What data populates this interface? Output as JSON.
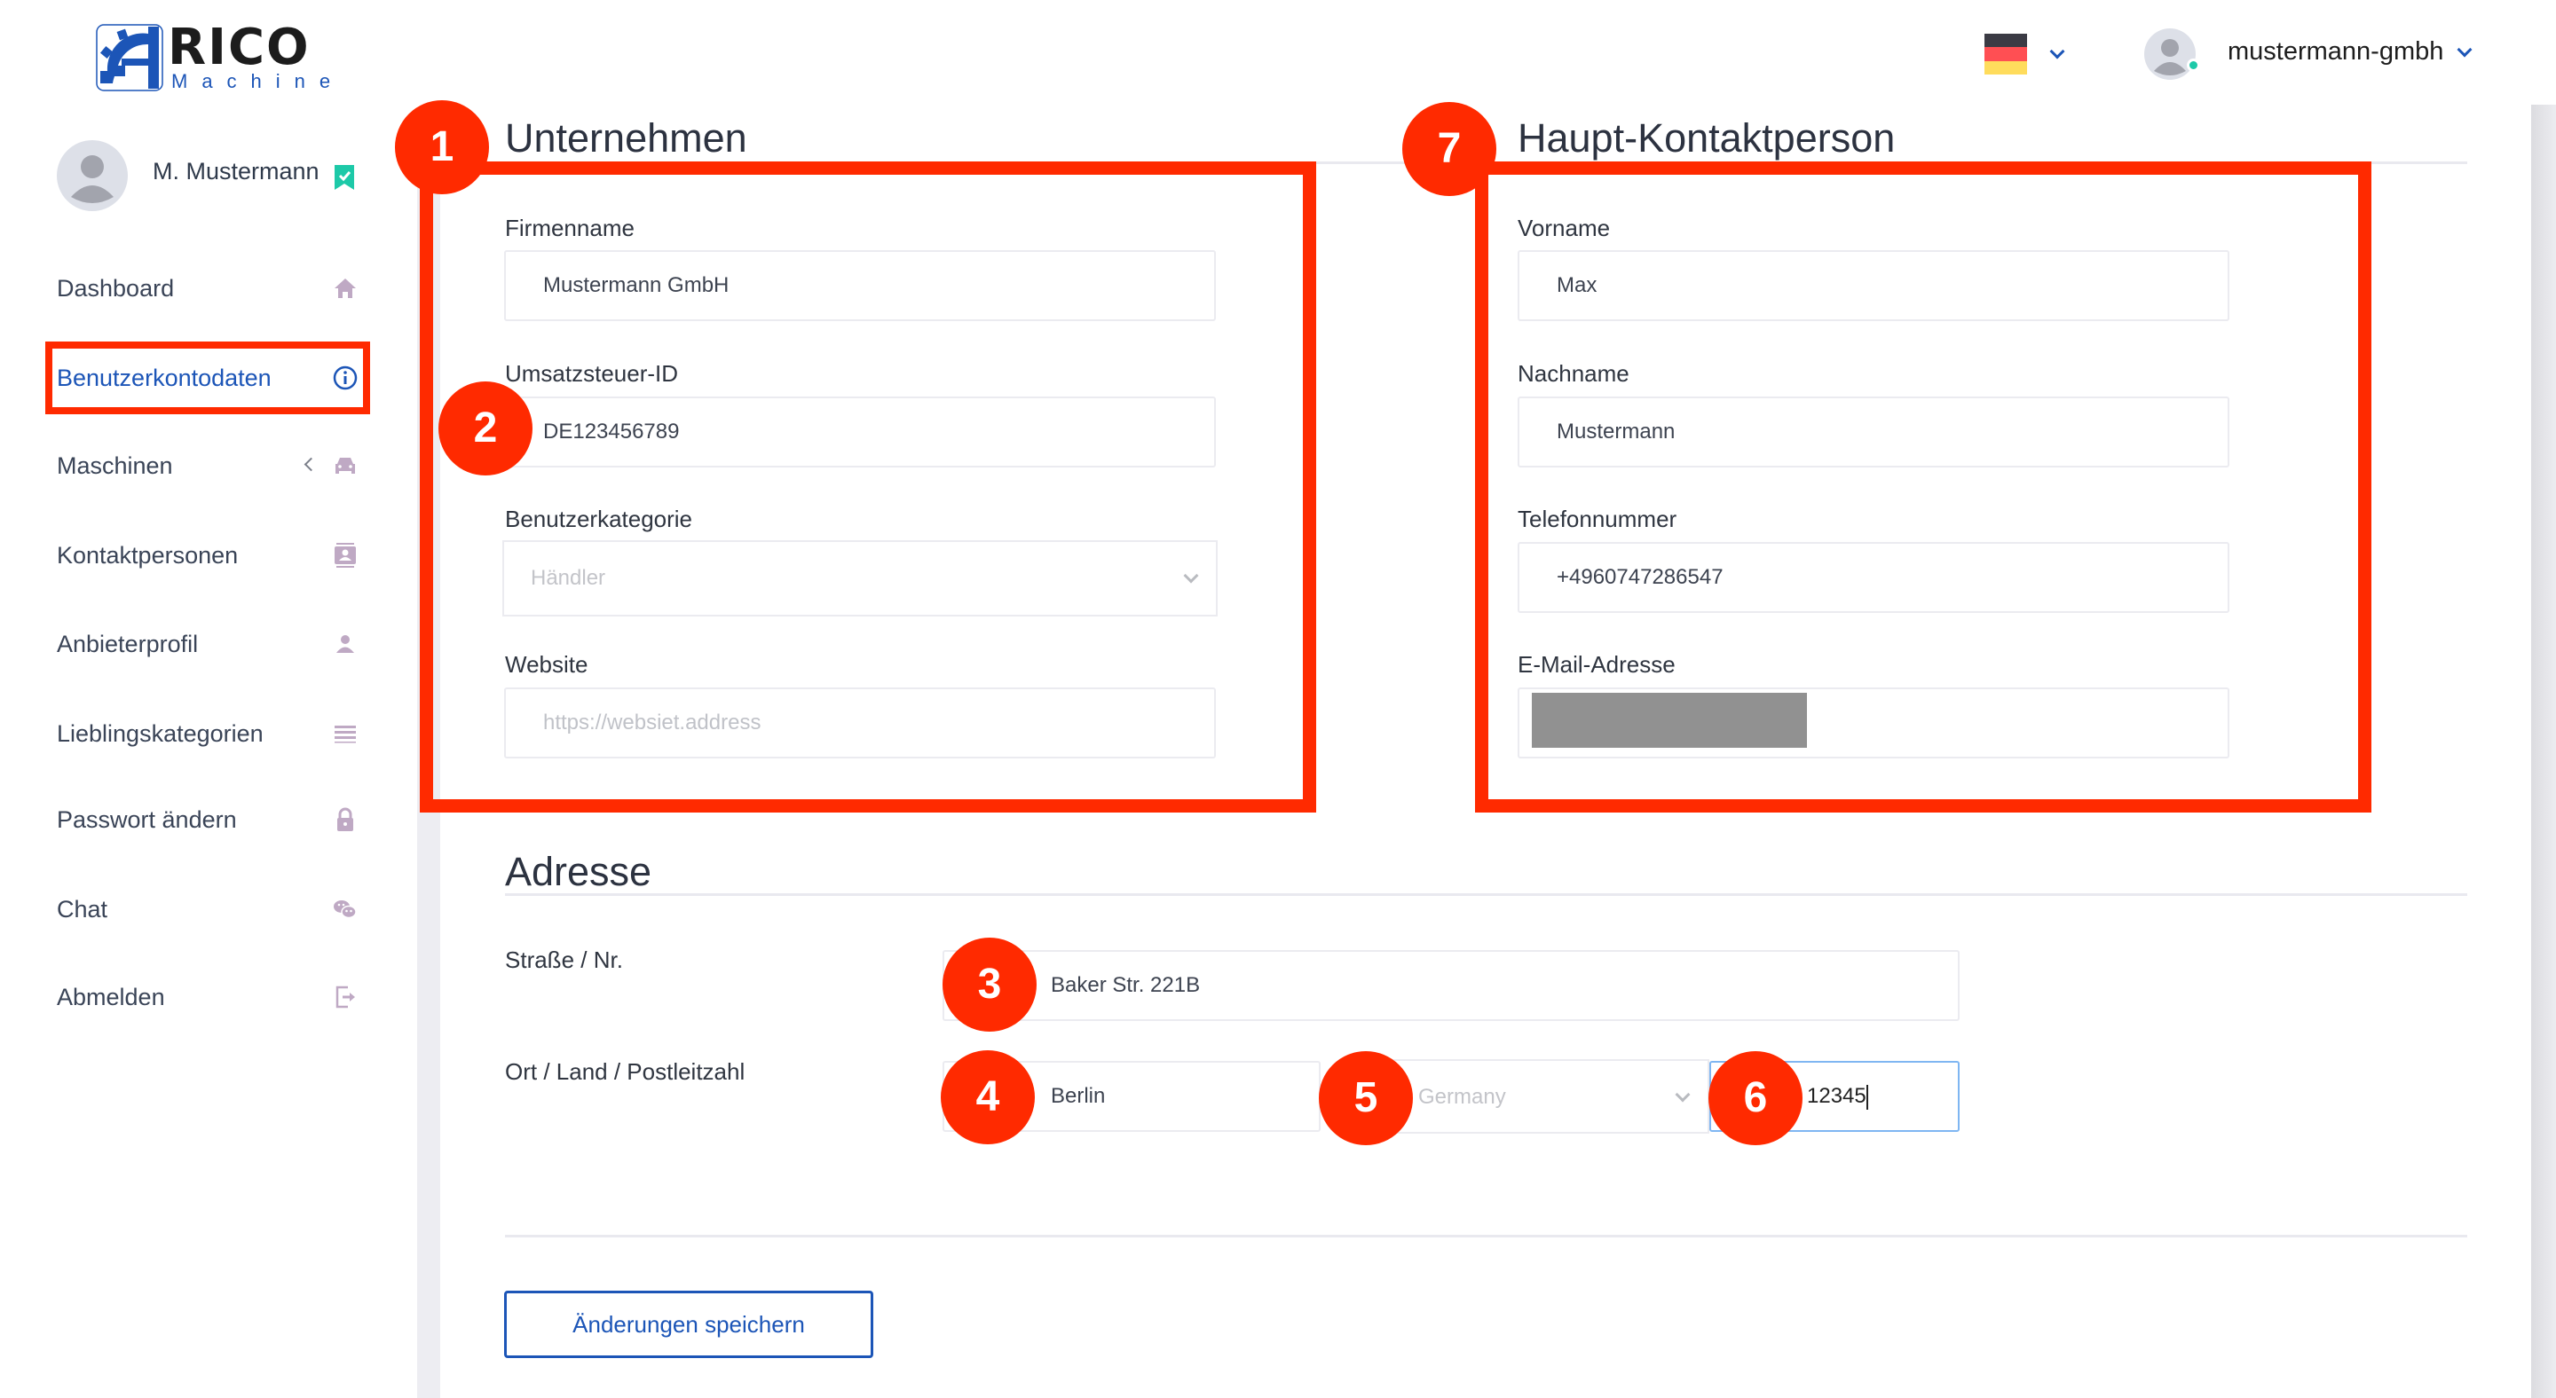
{
  "brand": {
    "name": "RICO",
    "tagline": "Machine",
    "logo_icon": "gear-a-logo-icon",
    "brand_color": "#1c55b7"
  },
  "header": {
    "language": {
      "flag": "de-flag-icon",
      "chevron": "chevron-down-icon"
    },
    "account": {
      "name": "mustermann-gmbh",
      "status_color": "#1dc9a8",
      "chevron": "chevron-down-icon"
    }
  },
  "sidebar": {
    "profile": {
      "name": "M. Mustermann",
      "verified_icon": "verified-badge-icon",
      "verified_color": "#1dc9a8"
    },
    "items": [
      {
        "label": "Dashboard",
        "icon": "home-icon",
        "active": false
      },
      {
        "label": "Benutzerkontodaten",
        "icon": "info-icon",
        "active": true
      },
      {
        "label": "Maschinen",
        "icon": "car-icon",
        "active": false,
        "has_submenu": true
      },
      {
        "label": "Kontaktpersonen",
        "icon": "contact-card-icon",
        "active": false
      },
      {
        "label": "Anbieterprofil",
        "icon": "user-icon",
        "active": false
      },
      {
        "label": "Lieblingskategorien",
        "icon": "list-icon",
        "active": false
      },
      {
        "label": "Passwort ändern",
        "icon": "lock-icon",
        "active": false
      },
      {
        "label": "Chat",
        "icon": "chat-icon",
        "active": false
      },
      {
        "label": "Abmelden",
        "icon": "logout-icon",
        "active": false
      }
    ]
  },
  "company": {
    "title": "Unternehmen",
    "fields": {
      "firmenname": {
        "label": "Firmenname",
        "value": "Mustermann GmbH"
      },
      "ust_id": {
        "label": "Umsatzsteuer-ID",
        "value": "DE123456789"
      },
      "kategorie": {
        "label": "Benutzerkategorie",
        "value": "Händler"
      },
      "website": {
        "label": "Website",
        "value": "",
        "placeholder": "https://websiet.address"
      }
    }
  },
  "contact": {
    "title": "Haupt-Kontaktperson",
    "fields": {
      "vorname": {
        "label": "Vorname",
        "value": "Max"
      },
      "nachname": {
        "label": "Nachname",
        "value": "Mustermann"
      },
      "telefon": {
        "label": "Telefonnummer",
        "value": "+4960747286547"
      },
      "email": {
        "label": "E-Mail-Adresse",
        "value": "",
        "redacted": true
      }
    }
  },
  "address": {
    "title": "Adresse",
    "street_label": "Straße / Nr.",
    "street_value": "Baker Str. 221B",
    "city_row_label": "Ort / Land / Postleitzahl",
    "city_value": "Berlin",
    "country_value": "Germany",
    "zip_value": "12345"
  },
  "actions": {
    "save_label": "Änderungen speichern"
  },
  "annotations": {
    "color": "#ff2a00",
    "markers": [
      "1",
      "2",
      "3",
      "4",
      "5",
      "6",
      "7"
    ]
  }
}
